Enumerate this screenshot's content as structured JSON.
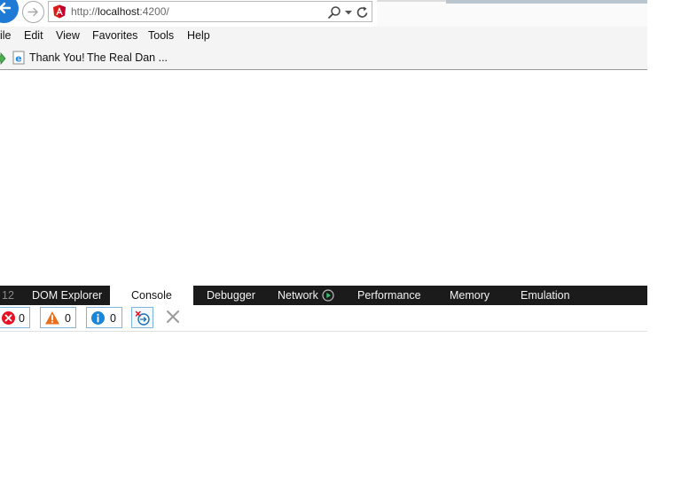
{
  "address_bar": {
    "url_scheme": "http://",
    "url_host": "localhost",
    "url_port_path": ":4200/"
  },
  "menu": {
    "items": [
      "ile",
      "Edit",
      "View",
      "Favorites",
      "Tools",
      "Help"
    ]
  },
  "favorites": {
    "items": [
      "Thank You!",
      "The Real Dan ..."
    ]
  },
  "devtools": {
    "number_tab": "12",
    "tabs": [
      "DOM Explorer",
      "Console",
      "Debugger",
      "Network",
      "Performance",
      "Memory",
      "Emulation"
    ],
    "active_tab": "Console"
  },
  "console": {
    "error_count": "0",
    "warning_count": "0",
    "info_count": "0"
  },
  "colors": {
    "accent": "#1f7ad6",
    "devtools_bar": "#1b1b1b",
    "error": "#e81123",
    "warning": "#e86f1e",
    "info": "#1a86d9"
  }
}
